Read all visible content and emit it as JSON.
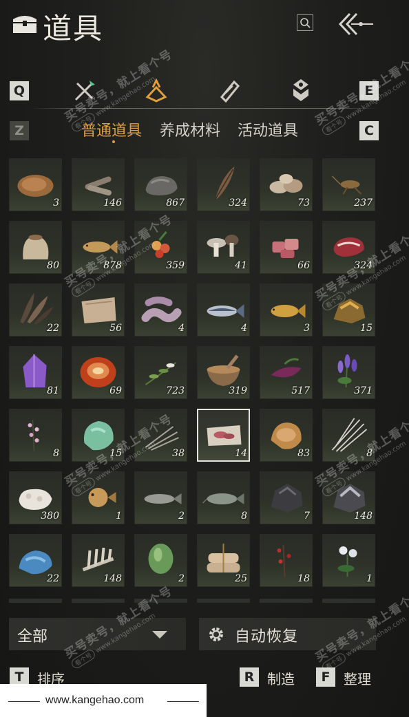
{
  "header": {
    "title": "道具"
  },
  "keys": {
    "prev_category": "Q",
    "next_category": "E",
    "prev_tab": "Z",
    "next_tab": "C"
  },
  "tabs": [
    {
      "label": "普通道具",
      "active": true
    },
    {
      "label": "养成材料",
      "active": false
    },
    {
      "label": "活动道具",
      "active": false
    }
  ],
  "items": [
    {
      "icon": "fur-pelt-icon",
      "count": "3"
    },
    {
      "icon": "wood-logs-icon",
      "count": "146"
    },
    {
      "icon": "stone-icon",
      "count": "867"
    },
    {
      "icon": "feather-icon",
      "count": "324"
    },
    {
      "icon": "shells-icon",
      "count": "73"
    },
    {
      "icon": "cricket-icon",
      "count": "237"
    },
    {
      "icon": "grain-sack-icon",
      "count": "80"
    },
    {
      "icon": "fish-icon",
      "count": "878"
    },
    {
      "icon": "berries-icon",
      "count": "359"
    },
    {
      "icon": "mushrooms-icon",
      "count": "41"
    },
    {
      "icon": "raw-meat-icon",
      "count": "66"
    },
    {
      "icon": "steak-icon",
      "count": "324"
    },
    {
      "icon": "feathers-bundle-icon",
      "count": "22"
    },
    {
      "icon": "animal-hide-icon",
      "count": "56"
    },
    {
      "icon": "cloth-icon",
      "count": "4"
    },
    {
      "icon": "tuna-icon",
      "count": "4"
    },
    {
      "icon": "carp-icon",
      "count": "3"
    },
    {
      "icon": "gold-ore-icon",
      "count": "15"
    },
    {
      "icon": "amethyst-icon",
      "count": "81"
    },
    {
      "icon": "red-agate-icon",
      "count": "69"
    },
    {
      "icon": "herb-sprig-icon",
      "count": "723"
    },
    {
      "icon": "mortar-bowl-icon",
      "count": "319"
    },
    {
      "icon": "purple-leaf-icon",
      "count": "517"
    },
    {
      "icon": "lavender-icon",
      "count": "371"
    },
    {
      "icon": "pink-blossom-icon",
      "count": "8"
    },
    {
      "icon": "jade-stone-icon",
      "count": "15"
    },
    {
      "icon": "dry-grass-icon",
      "count": "38"
    },
    {
      "icon": "meat-on-paper-icon",
      "count": "14",
      "selected": true
    },
    {
      "icon": "fox-fur-icon",
      "count": "83"
    },
    {
      "icon": "porcupine-quills-icon",
      "count": "8"
    },
    {
      "icon": "white-fleece-icon",
      "count": "380"
    },
    {
      "icon": "pufferfish-icon",
      "count": "1"
    },
    {
      "icon": "mackerel-icon",
      "count": "2"
    },
    {
      "icon": "catfish-icon",
      "count": "8"
    },
    {
      "icon": "dark-ore-icon",
      "count": "7"
    },
    {
      "icon": "silver-ore-icon",
      "count": "148"
    },
    {
      "icon": "blue-crystal-icon",
      "count": "22"
    },
    {
      "icon": "rib-bone-icon",
      "count": "148"
    },
    {
      "icon": "melon-icon",
      "count": "2"
    },
    {
      "icon": "tied-bundles-icon",
      "count": "25"
    },
    {
      "icon": "red-berry-branch-icon",
      "count": "18"
    },
    {
      "icon": "white-flowers-icon",
      "count": "1"
    }
  ],
  "bottom": {
    "filter": "全部",
    "auto_restore": "自动恢复",
    "sort_key": "T",
    "sort": "排序",
    "craft_key": "R",
    "craft": "制造",
    "tidy_key": "F",
    "tidy": "整理"
  },
  "watermark": {
    "line1": "买号卖号，就上看个号",
    "line2": "www.kangehao.com",
    "badge": "看个号"
  },
  "footer": {
    "url": "www.kangehao.com"
  }
}
